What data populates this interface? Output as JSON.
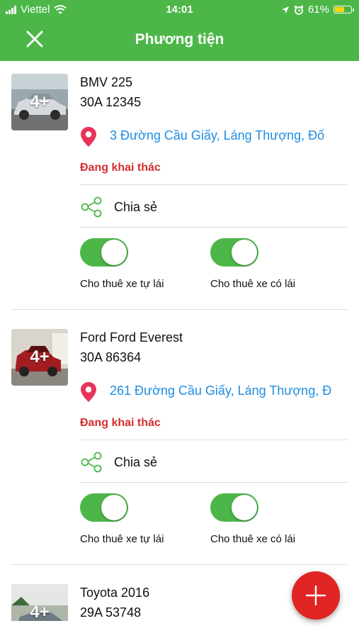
{
  "status_bar": {
    "carrier": "Viettel",
    "time": "14:01",
    "battery_percent": "61%",
    "battery_level": 0.61,
    "icons": [
      "signal-icon",
      "wifi-icon",
      "location-arrow-icon",
      "alarm-icon",
      "battery-icon"
    ]
  },
  "header": {
    "title": "Phương tiện",
    "close_icon": "close-icon"
  },
  "colors": {
    "brand_green": "#4cb748",
    "link_blue": "#1f8ce0",
    "status_red": "#d32f2f",
    "fab_red": "#e12424"
  },
  "vehicles": [
    {
      "name": "BMV 225",
      "plate": "30A 12345",
      "photo_count": "4+",
      "address": "3 Đường Cầu Giấy, Láng Thượng, Đố",
      "status": "Đang khai thác",
      "share_label": "Chia sẻ",
      "toggle_self_drive": {
        "label": "Cho thuê xe tự lái",
        "on": true
      },
      "toggle_with_driver": {
        "label": "Cho thuê xe có lái",
        "on": true
      }
    },
    {
      "name": "Ford Ford Everest",
      "plate": "30A 86364",
      "photo_count": "4+",
      "address": "261 Đường Cầu Giấy, Láng Thượng, Đ",
      "status": "Đang khai thác",
      "share_label": "Chia sẻ",
      "toggle_self_drive": {
        "label": "Cho thuê xe tự lái",
        "on": true
      },
      "toggle_with_driver": {
        "label": "Cho thuê xe có lái",
        "on": true
      }
    },
    {
      "name": "Toyota 2016",
      "plate": "29A 53748",
      "photo_count": "4+"
    }
  ],
  "fab": {
    "icon": "plus-icon"
  }
}
